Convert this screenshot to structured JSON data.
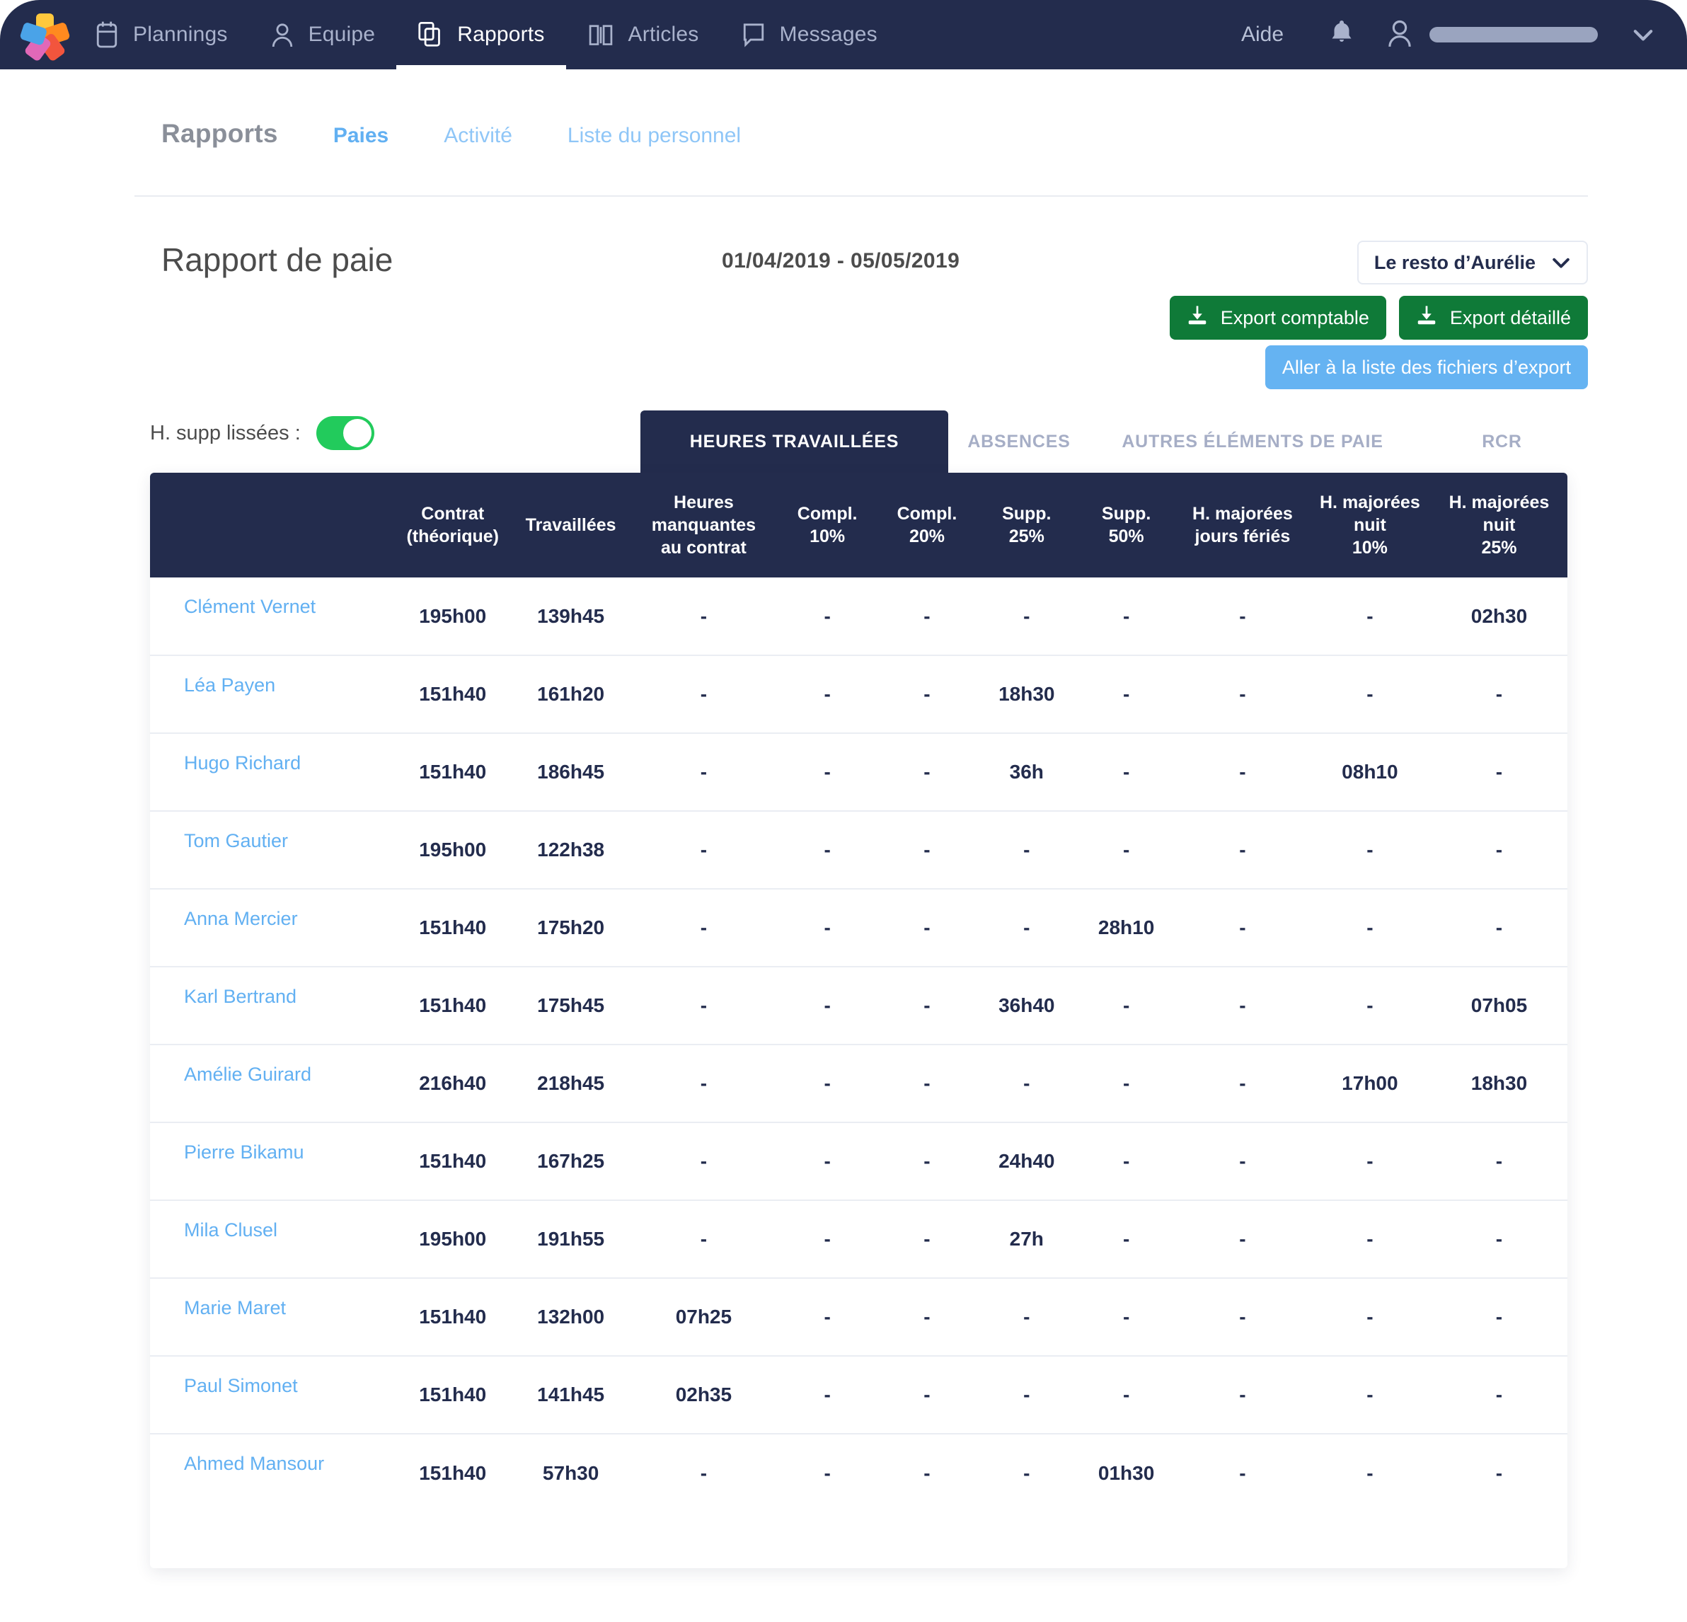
{
  "topnav": {
    "logo_name": "combo-logo",
    "items": [
      {
        "label": "Plannings",
        "icon": "calendar-icon",
        "active": false
      },
      {
        "label": "Equipe",
        "icon": "user-icon",
        "active": false
      },
      {
        "label": "Rapports",
        "icon": "copies-icon",
        "active": true
      },
      {
        "label": "Articles",
        "icon": "book-icon",
        "active": false
      },
      {
        "label": "Messages",
        "icon": "chat-icon",
        "active": false
      }
    ],
    "help_label": "Aide",
    "bell_icon": "bell-icon",
    "account_icon": "user-avatar-icon",
    "account_name_redacted": "",
    "account_chevron": "chevron-down-icon"
  },
  "subnav": {
    "title": "Rapports",
    "links": [
      {
        "label": "Paies",
        "active": true
      },
      {
        "label": "Activité",
        "active": false
      },
      {
        "label": "Liste du personnel",
        "active": false
      }
    ]
  },
  "header": {
    "page_title": "Rapport de paie",
    "date_range": "01/04/2019 - 05/05/2019",
    "shop_select_value": "Le resto d’Aurélie",
    "shop_select_chevron": "chevron-down-icon",
    "export_comptable_label": "Export comptable",
    "export_detaille_label": "Export détaillé",
    "export_files_link_label": "Aller à la liste des fichiers d’export",
    "download_icon": "download-icon"
  },
  "controls": {
    "smoothed_toggle_label": "H. supp lissées :",
    "smoothed_toggle_on": true
  },
  "tabs": [
    {
      "label": "HEURES TRAVAILLÉES",
      "active": true
    },
    {
      "label": "ABSENCES",
      "active": false
    },
    {
      "label": "AUTRES ÉLÉMENTS DE PAIE",
      "active": false
    },
    {
      "label": "RCR",
      "active": false
    }
  ],
  "table": {
    "columns": [
      "",
      "Contrat\n(théorique)",
      "Travaillées",
      "Heures\nmanquantes\nau contrat",
      "Compl.\n10%",
      "Compl.\n20%",
      "Supp.\n25%",
      "Supp.\n50%",
      "H. majorées\njours fériés",
      "H. majorées\nnuit\n10%",
      "H. majorées\nnuit\n25%"
    ],
    "rows": [
      {
        "name": "Clément Vernet",
        "values": [
          "195h00",
          "139h45",
          "-",
          "-",
          "-",
          "-",
          "-",
          "-",
          "-",
          "02h30"
        ]
      },
      {
        "name": "Léa Payen",
        "values": [
          "151h40",
          "161h20",
          "-",
          "-",
          "-",
          "18h30",
          "-",
          "-",
          "-",
          "-"
        ]
      },
      {
        "name": "Hugo Richard",
        "values": [
          "151h40",
          "186h45",
          "-",
          "-",
          "-",
          "36h",
          "-",
          "-",
          "08h10",
          "-"
        ]
      },
      {
        "name": "Tom Gautier",
        "values": [
          "195h00",
          "122h38",
          "-",
          "-",
          "-",
          "-",
          "-",
          "-",
          "-",
          "-"
        ]
      },
      {
        "name": "Anna Mercier",
        "values": [
          "151h40",
          "175h20",
          "-",
          "-",
          "-",
          "-",
          "28h10",
          "-",
          "-",
          "-"
        ]
      },
      {
        "name": "Karl Bertrand",
        "values": [
          "151h40",
          "175h45",
          "-",
          "-",
          "-",
          "36h40",
          "-",
          "-",
          "-",
          "07h05"
        ]
      },
      {
        "name": "Amélie Guirard",
        "values": [
          "216h40",
          "218h45",
          "-",
          "-",
          "-",
          "-",
          "-",
          "-",
          "17h00",
          "18h30"
        ]
      },
      {
        "name": "Pierre Bikamu",
        "values": [
          "151h40",
          "167h25",
          "-",
          "-",
          "-",
          "24h40",
          "-",
          "-",
          "-",
          "-"
        ]
      },
      {
        "name": "Mila Clusel",
        "values": [
          "195h00",
          "191h55",
          "-",
          "-",
          "-",
          "27h",
          "-",
          "-",
          "-",
          "-"
        ]
      },
      {
        "name": "Marie Maret",
        "values": [
          "151h40",
          "132h00",
          "07h25",
          "-",
          "-",
          "-",
          "-",
          "-",
          "-",
          "-"
        ]
      },
      {
        "name": "Paul Simonet",
        "values": [
          "151h40",
          "141h45",
          "02h35",
          "-",
          "-",
          "-",
          "-",
          "-",
          "-",
          "-"
        ]
      },
      {
        "name": "Ahmed Mansour",
        "values": [
          "151h40",
          "57h30",
          "-",
          "-",
          "-",
          "-",
          "01h30",
          "-",
          "-",
          "-"
        ]
      }
    ]
  },
  "colors": {
    "navy": "#232c4d",
    "link_blue": "#62b0f2",
    "green": "#0f7a38",
    "toggle_green": "#22cb5c",
    "light_blue_button": "#65b3f2"
  }
}
